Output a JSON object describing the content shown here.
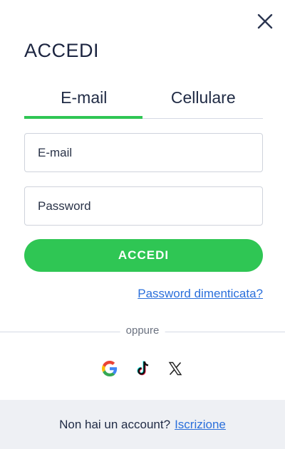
{
  "title": "ACCEDI",
  "tabs": [
    {
      "label": "E-mail",
      "active": true
    },
    {
      "label": "Cellulare",
      "active": false
    }
  ],
  "form": {
    "email_placeholder": "E-mail",
    "email_value": "",
    "password_placeholder": "Password",
    "password_value": "",
    "submit_label": "ACCEDI",
    "forgot_label": "Password dimenticata?"
  },
  "divider_label": "oppure",
  "social": [
    {
      "icon": "google-icon"
    },
    {
      "icon": "tiktok-icon"
    },
    {
      "icon": "x-icon"
    }
  ],
  "footer": {
    "text": "Non hai un account?",
    "link": "Iscrizione"
  },
  "colors": {
    "accent": "#2fc654",
    "link": "#2a6fdb",
    "footer_bg": "#eef0f4"
  },
  "icons": {
    "close": "close-icon"
  }
}
